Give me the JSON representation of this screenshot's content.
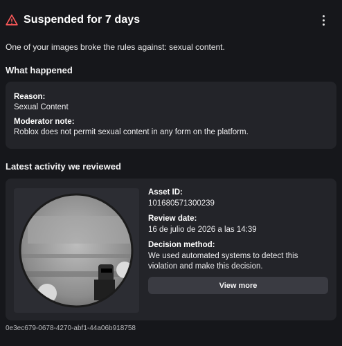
{
  "header": {
    "title": "Suspended for 7 days",
    "icon": "warning-triangle-icon",
    "accent_color": "#ff5a5a"
  },
  "intro": "One of your images broke the rules against: sexual content.",
  "what_happened": {
    "title": "What happened",
    "reason_label": "Reason:",
    "reason_value": "Sexual Content",
    "note_label": "Moderator note:",
    "note_value": "Roblox does not permit sexual content in any form on the platform."
  },
  "activity": {
    "title": "Latest activity we reviewed",
    "asset_label": "Asset ID:",
    "asset_value": "101680571300239",
    "review_label": "Review date:",
    "review_value": "16 de julio de 2026 a las 14:39",
    "method_label": "Decision method:",
    "method_value": "We used automated systems to detect this violation and make this decision.",
    "view_more": "View more"
  },
  "footer_id": "0e3ec679-0678-4270-abf1-44a06b918758"
}
